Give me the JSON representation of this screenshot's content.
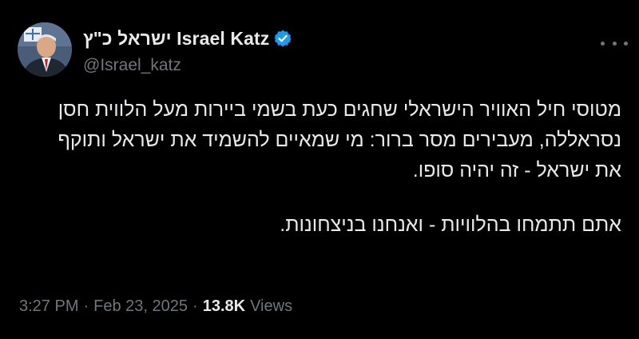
{
  "author": {
    "display_name": "ישראל כ\"ץ Israel Katz",
    "handle": "@Israel_katz",
    "verified": true,
    "verified_color": "#1d9bf0",
    "avatar_icon": "profile-photo"
  },
  "tweet": {
    "paragraph_1": "מטוסי חיל האוויר הישראלי שחגים כעת בשמי ביירות מעל הלווית חסן נסראללה, מעבירים מסר ברור: מי שמאיים להשמיד את ישראל ותוקף את ישראל - זה יהיה סופו.",
    "paragraph_2": "אתם תתמחו בהלוויות - ואנחנו בניצחונות."
  },
  "meta": {
    "time": "3:27 PM",
    "separator": "·",
    "date": "Feb 23, 2025",
    "views_count": "13.8K",
    "views_label": "Views"
  },
  "colors": {
    "background": "#000000",
    "primary_text": "#e7e9ea",
    "secondary_text": "#71767b"
  },
  "icons": {
    "more": "more-horizontal-icon",
    "verified": "verified-badge-icon"
  }
}
